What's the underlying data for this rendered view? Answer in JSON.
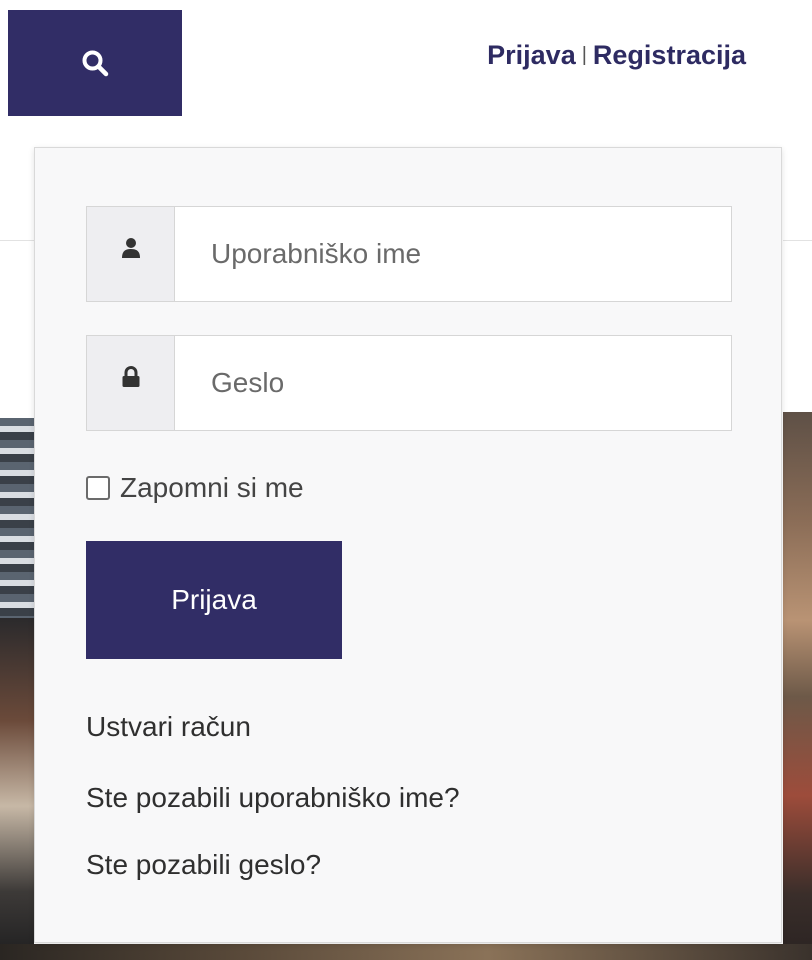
{
  "header": {
    "search_icon": "search-icon",
    "login_link": "Prijava",
    "separator": "|",
    "register_link": "Registracija",
    "accent_color": "#312d66"
  },
  "login_form": {
    "username": {
      "icon": "user-icon",
      "placeholder": "Uporabniško ime",
      "value": ""
    },
    "password": {
      "icon": "lock-icon",
      "placeholder": "Geslo",
      "value": ""
    },
    "remember_me": {
      "label": "Zapomni si me",
      "checked": false
    },
    "submit_label": "Prijava",
    "links": {
      "create_account": "Ustvari račun",
      "forgot_username": "Ste pozabili uporabniško ime?",
      "forgot_password": "Ste pozabili geslo?"
    }
  }
}
